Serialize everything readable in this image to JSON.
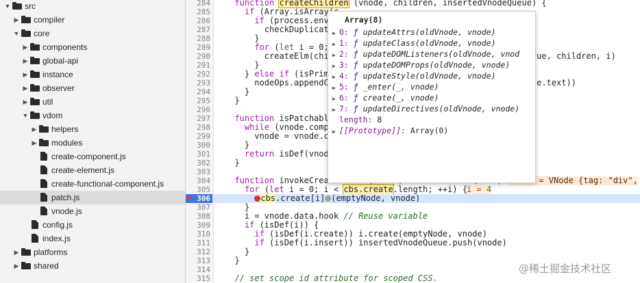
{
  "file_tree": [
    {
      "label": "src",
      "kind": "folder",
      "open": true,
      "depth": 0
    },
    {
      "label": "compiler",
      "kind": "folder",
      "open": false,
      "depth": 1
    },
    {
      "label": "core",
      "kind": "folder",
      "open": true,
      "depth": 1
    },
    {
      "label": "components",
      "kind": "folder",
      "open": false,
      "depth": 2
    },
    {
      "label": "global-api",
      "kind": "folder",
      "open": false,
      "depth": 2
    },
    {
      "label": "instance",
      "kind": "folder",
      "open": false,
      "depth": 2
    },
    {
      "label": "observer",
      "kind": "folder",
      "open": false,
      "depth": 2
    },
    {
      "label": "util",
      "kind": "folder",
      "open": false,
      "depth": 2
    },
    {
      "label": "vdom",
      "kind": "folder",
      "open": true,
      "depth": 2
    },
    {
      "label": "helpers",
      "kind": "folder",
      "open": false,
      "depth": 3
    },
    {
      "label": "modules",
      "kind": "folder",
      "open": false,
      "depth": 3
    },
    {
      "label": "create-component.js",
      "kind": "file",
      "depth": 3
    },
    {
      "label": "create-element.js",
      "kind": "file",
      "depth": 3
    },
    {
      "label": "create-functional-component.js",
      "kind": "file",
      "depth": 3
    },
    {
      "label": "patch.js",
      "kind": "file",
      "depth": 3,
      "selected": true
    },
    {
      "label": "vnode.js",
      "kind": "file",
      "depth": 3
    },
    {
      "label": "config.js",
      "kind": "file",
      "depth": 2
    },
    {
      "label": "index.js",
      "kind": "file",
      "depth": 2
    },
    {
      "label": "platforms",
      "kind": "folder",
      "open": false,
      "depth": 1
    },
    {
      "label": "shared",
      "kind": "folder",
      "open": false,
      "depth": 1
    }
  ],
  "code_lines": [
    {
      "n": "284",
      "text": "  function createChildren (vnode, children, insertedVnodeQueue) {"
    },
    {
      "n": "285",
      "text": "    if (Array.isArray(c"
    },
    {
      "n": "286",
      "text": "      if (process.env.N"
    },
    {
      "n": "287",
      "text": "        checkDuplicateK"
    },
    {
      "n": "288",
      "text": "      }"
    },
    {
      "n": "289",
      "text": "      for (let i = 0; i"
    },
    {
      "n": "290",
      "text": "        createElm(chilc                                  ll, true, children, i)"
    },
    {
      "n": "291",
      "text": "      }"
    },
    {
      "n": "292",
      "text": "    } else if (isPrimit"
    },
    {
      "n": "293",
      "text": "      nodeOps.appendChi                                 ng(vnode.text))"
    },
    {
      "n": "294",
      "text": "    }"
    },
    {
      "n": "295",
      "text": "  }"
    },
    {
      "n": "296",
      "text": ""
    },
    {
      "n": "297",
      "text": "  function isPatchable"
    },
    {
      "n": "298",
      "text": "    while (vnode.compor"
    },
    {
      "n": "299",
      "text": "      vnode = vnode.com"
    },
    {
      "n": "300",
      "text": "    }"
    },
    {
      "n": "301",
      "text": "    return isDef(vnode."
    },
    {
      "n": "302",
      "text": "  }"
    },
    {
      "n": "303",
      "text": ""
    },
    {
      "n": "304",
      "text": "  function invokeCreateHooks (vnode, insertedVnodeQueue) {"
    },
    {
      "n": "305",
      "text": "    for (let i = 0; i < cbs.create.length; ++i) {"
    },
    {
      "n": "306",
      "text": "      cbs.create[i](emptyNode, vnode)"
    },
    {
      "n": "307",
      "text": "    }"
    },
    {
      "n": "308",
      "text": "    i = vnode.data.hook // Reuse variable"
    },
    {
      "n": "309",
      "text": "    if (isDef(i)) {"
    },
    {
      "n": "310",
      "text": "      if (isDef(i.create)) i.create(emptyNode, vnode)"
    },
    {
      "n": "311",
      "text": "      if (isDef(i.insert)) insertedVnodeQueue.push(vnode)"
    },
    {
      "n": "312",
      "text": "    }"
    },
    {
      "n": "313",
      "text": "  }"
    },
    {
      "n": "314",
      "text": ""
    },
    {
      "n": "315",
      "text": "  // set scope id attribute for scoped CSS."
    }
  ],
  "inline_values": {
    "line_304": "vnode = VNode {tag: \"div\",",
    "line_305": "i = 4"
  },
  "popup": {
    "title": "Array(8)",
    "items": [
      {
        "index": "0:",
        "f": "ƒ",
        "sig": "updateAttrs(oldVnode, vnode)"
      },
      {
        "index": "1:",
        "f": "ƒ",
        "sig": "updateClass(oldVnode, vnode)"
      },
      {
        "index": "2:",
        "f": "ƒ",
        "sig": "updateDOMListeners(oldVnode, vnod"
      },
      {
        "index": "3:",
        "f": "ƒ",
        "sig": "updateDOMProps(oldVnode, vnode)"
      },
      {
        "index": "4:",
        "f": "ƒ",
        "sig": "updateStyle(oldVnode, vnode)"
      },
      {
        "index": "5:",
        "f": "ƒ",
        "sig": "_enter(_, vnode)"
      },
      {
        "index": "6:",
        "f": "ƒ",
        "sig": "create(_, vnode)"
      },
      {
        "index": "7:",
        "f": "ƒ",
        "sig": "updateDirectives(oldVnode, vnode)"
      }
    ],
    "length_key": "length:",
    "length_value": "8",
    "proto_key": "[[Prototype]]:",
    "proto_value": "Array(0)"
  },
  "watermark": "@稀土掘金技术社区",
  "colors": {
    "breakpoint": "#3d74d9",
    "exec_line": "#d4e4ff",
    "keyword": "#9b1fa8",
    "comment": "#236e25"
  }
}
